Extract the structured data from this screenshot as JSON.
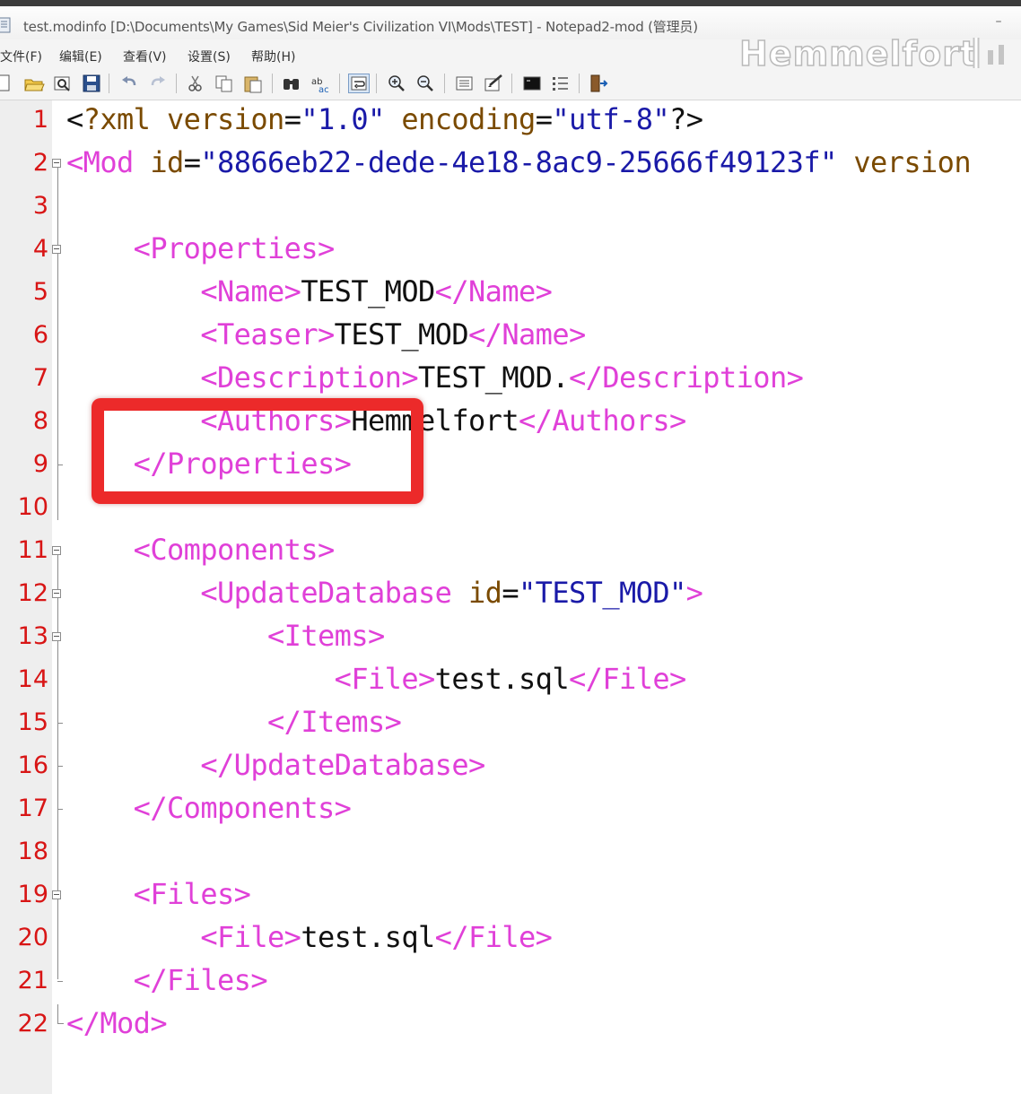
{
  "window": {
    "title": "test.modinfo [D:\\Documents\\My Games\\Sid Meier's Civilization VI\\Mods\\TEST] - Notepad2-mod (管理员)",
    "minimize_glyph": "–"
  },
  "menu": {
    "items": [
      {
        "label": "文件(F)"
      },
      {
        "label": "编辑(E)"
      },
      {
        "label": "查看(V)"
      },
      {
        "label": "设置(S)"
      },
      {
        "label": "帮助(H)"
      }
    ]
  },
  "watermark": {
    "text": "Hemmelfort"
  },
  "toolbar": {
    "buttons": [
      {
        "icon": "new-file-icon"
      },
      {
        "icon": "open-folder-icon"
      },
      {
        "icon": "browse-icon"
      },
      {
        "icon": "save-icon"
      },
      {
        "icon": "undo-icon"
      },
      {
        "icon": "redo-icon"
      },
      {
        "icon": "cut-icon"
      },
      {
        "icon": "copy-icon"
      },
      {
        "icon": "paste-icon"
      },
      {
        "icon": "find-icon"
      },
      {
        "icon": "replace-icon"
      },
      {
        "icon": "word-wrap-icon"
      },
      {
        "icon": "zoom-in-icon"
      },
      {
        "icon": "zoom-out-icon"
      },
      {
        "icon": "select-scheme-icon"
      },
      {
        "icon": "customize-scheme-icon"
      },
      {
        "icon": "run-icon"
      },
      {
        "icon": "favorites-icon"
      },
      {
        "icon": "exit-icon"
      }
    ]
  },
  "editor": {
    "lines": [
      {
        "no": "1",
        "parts": [
          [
            "t-punct",
            "<"
          ],
          [
            "t-pi",
            "?xml "
          ],
          [
            "t-attr",
            "version"
          ],
          [
            "t-punct",
            "="
          ],
          [
            "t-val",
            "\"1.0\""
          ],
          [
            "t-punct",
            " "
          ],
          [
            "t-attr",
            "encoding"
          ],
          [
            "t-punct",
            "="
          ],
          [
            "t-val",
            "\"utf-8\""
          ],
          [
            "t-punct",
            "?>"
          ]
        ]
      },
      {
        "no": "2",
        "parts": [
          [
            "t-tag",
            "<Mod "
          ],
          [
            "t-attr",
            "id"
          ],
          [
            "t-punct",
            "="
          ],
          [
            "t-val",
            "\"8866eb22-dede-4e18-8ac9-25666f49123f\""
          ],
          [
            "t-punct",
            " "
          ],
          [
            "t-attr",
            "version"
          ]
        ]
      },
      {
        "no": "3",
        "parts": []
      },
      {
        "no": "4",
        "parts": [
          [
            "t-text",
            "    "
          ],
          [
            "t-tag",
            "<Properties>"
          ]
        ]
      },
      {
        "no": "5",
        "parts": [
          [
            "t-text",
            "        "
          ],
          [
            "t-tag",
            "<Name>"
          ],
          [
            "t-text",
            "TEST_MOD"
          ],
          [
            "t-tag",
            "</Name>"
          ]
        ]
      },
      {
        "no": "6",
        "parts": [
          [
            "t-text",
            "        "
          ],
          [
            "t-tag",
            "<Teaser>"
          ],
          [
            "t-text",
            "TEST_MOD"
          ],
          [
            "t-tag",
            "</Name>"
          ]
        ]
      },
      {
        "no": "7",
        "parts": [
          [
            "t-text",
            "        "
          ],
          [
            "t-tag",
            "<Description>"
          ],
          [
            "t-text",
            "TEST_MOD."
          ],
          [
            "t-tag",
            "</Description>"
          ]
        ]
      },
      {
        "no": "8",
        "parts": [
          [
            "t-text",
            "        "
          ],
          [
            "t-tag",
            "<Authors>"
          ],
          [
            "t-text",
            "Hemmelfort"
          ],
          [
            "t-tag",
            "</Authors>"
          ]
        ]
      },
      {
        "no": "9",
        "parts": [
          [
            "t-text",
            "    "
          ],
          [
            "t-tag",
            "</Properties>"
          ]
        ]
      },
      {
        "no": "10",
        "parts": []
      },
      {
        "no": "11",
        "parts": [
          [
            "t-text",
            "    "
          ],
          [
            "t-tag",
            "<Components>"
          ]
        ]
      },
      {
        "no": "12",
        "parts": [
          [
            "t-text",
            "        "
          ],
          [
            "t-tag",
            "<UpdateDatabase "
          ],
          [
            "t-attr",
            "id"
          ],
          [
            "t-punct",
            "="
          ],
          [
            "t-val",
            "\"TEST_MOD\""
          ],
          [
            "t-tag",
            ">"
          ]
        ]
      },
      {
        "no": "13",
        "parts": [
          [
            "t-text",
            "            "
          ],
          [
            "t-tag",
            "<Items>"
          ]
        ]
      },
      {
        "no": "14",
        "parts": [
          [
            "t-text",
            "                "
          ],
          [
            "t-tag",
            "<File>"
          ],
          [
            "t-text",
            "test.sql"
          ],
          [
            "t-tag",
            "</File>"
          ]
        ]
      },
      {
        "no": "15",
        "parts": [
          [
            "t-text",
            "            "
          ],
          [
            "t-tag",
            "</Items>"
          ]
        ]
      },
      {
        "no": "16",
        "parts": [
          [
            "t-text",
            "        "
          ],
          [
            "t-tag",
            "</UpdateDatabase>"
          ]
        ]
      },
      {
        "no": "17",
        "parts": [
          [
            "t-text",
            "    "
          ],
          [
            "t-tag",
            "</Components>"
          ]
        ]
      },
      {
        "no": "18",
        "parts": []
      },
      {
        "no": "19",
        "parts": [
          [
            "t-text",
            "    "
          ],
          [
            "t-tag",
            "<Files>"
          ]
        ]
      },
      {
        "no": "20",
        "parts": [
          [
            "t-text",
            "        "
          ],
          [
            "t-tag",
            "<File>"
          ],
          [
            "t-text",
            "test.sql"
          ],
          [
            "t-tag",
            "</File>"
          ]
        ]
      },
      {
        "no": "21",
        "parts": [
          [
            "t-text",
            "    "
          ],
          [
            "t-tag",
            "</Files>"
          ]
        ]
      },
      {
        "no": "22",
        "parts": [
          [
            "t-tag",
            "</Mod>"
          ]
        ]
      }
    ],
    "fold_open_lines": [
      "2",
      "4",
      "11",
      "12",
      "13",
      "19"
    ],
    "fold_tick_lines": [
      "9",
      "15",
      "16",
      "17",
      "21"
    ],
    "fold_end_lines": [
      "22"
    ],
    "highlight_color": "#ec2a2a",
    "tag_color": "#e040d8",
    "line_number_color": "#d81515"
  }
}
